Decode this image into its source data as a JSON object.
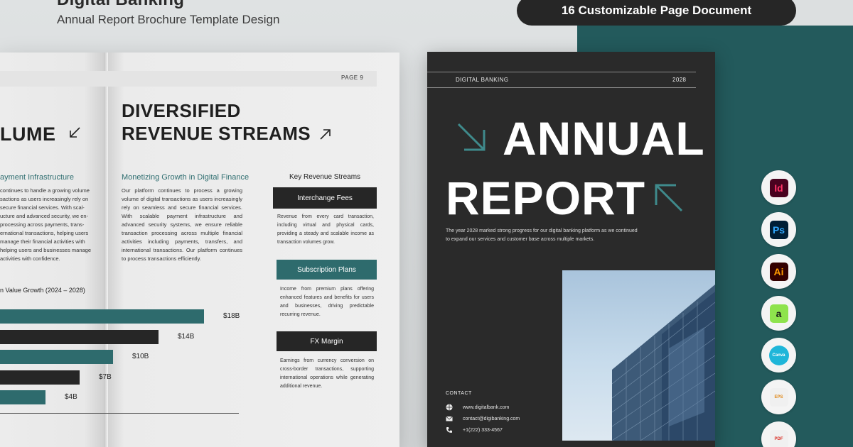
{
  "header": {
    "title": "Digital Banking",
    "subtitle": "Annual Report Brochure Template Design",
    "badge": "16 Customizable Page Document"
  },
  "spread": {
    "page_number": "PAGE 9",
    "left": {
      "title_fragment": "LUME",
      "heading": "ayment Infrastructure",
      "paragraph": "continues to handle a growing volume sactions as users increasingly rely on secure financial services. With scal-ucture and advanced security, we en-processing across payments, trans-ernational transactions, helping users manage their financial activities with helping users and businesses manage activities with confidence.",
      "chart_title": "n Value Growth (2024 – 2028)"
    },
    "middle": {
      "title": "DIVERSIFIED REVENUE STREAMS",
      "heading": "Monetizing Growth in Digital Finance",
      "paragraph": "Our platform continues to process a growing volume of digital transactions as users increasingly rely on seamless and secure financial services. With scalable payment infrastructure and advanced security systems, we ensure reliable transaction processing across multiple financial activities including payments, transfers, and international transactions. Our platform continues to process transactions efficiently."
    },
    "revenue": {
      "title": "Key Revenue Streams",
      "items": [
        {
          "label": "Interchange Fees",
          "text": "Revenue from every card transaction, including virtual and physical cards, providing a steady and scalable income as transaction volumes grow."
        },
        {
          "label": "Subscription Plans",
          "text": "Income from premium plans offering enhanced features and benefits for users and businesses, driving predictable recurring revenue."
        },
        {
          "label": "FX Margin",
          "text": "Earnings from currency conversion on cross-border transactions, supporting international operations while generating additional revenue."
        }
      ]
    }
  },
  "chart_data": {
    "type": "bar",
    "orientation": "horizontal",
    "title": "n Value Growth (2024 – 2028)",
    "values": [
      18,
      14,
      10,
      7,
      4
    ],
    "value_labels": [
      "$18B",
      "$14B",
      "$10B",
      "$7B",
      "$4B"
    ],
    "colors": [
      "#2e6b6d",
      "#262626",
      "#2e6b6d",
      "#262626",
      "#2e6b6d"
    ],
    "xlim": [
      0,
      21
    ]
  },
  "cover": {
    "brand": "DIGITAL BANKING",
    "year": "2028",
    "title_line1": "ANNUAL",
    "title_line2": "REPORT",
    "intro": "The year 2028 marked strong progress for our digital banking platform as we continued to expand our services and customer base across multiple markets.",
    "contact_heading": "CONTACT",
    "contacts": [
      {
        "icon": "globe-icon",
        "text": "www.digitalbank.com"
      },
      {
        "icon": "mail-icon",
        "text": "contact@digibanking.com"
      },
      {
        "icon": "phone-icon",
        "text": "+1(222) 333-4567"
      }
    ]
  },
  "apps": [
    {
      "name": "indesign-icon",
      "label": "Id",
      "bg": "#49021f",
      "fg": "#ff3366"
    },
    {
      "name": "photoshop-icon",
      "label": "Ps",
      "bg": "#001e36",
      "fg": "#31a8ff"
    },
    {
      "name": "illustrator-icon",
      "label": "Ai",
      "bg": "#330000",
      "fg": "#ff9a00"
    },
    {
      "name": "affinity-icon",
      "label": "a",
      "bg": "#8ee34d",
      "fg": "#1a1a1a"
    },
    {
      "name": "canva-icon",
      "label": "Canva",
      "bg": "#1fb6d9",
      "fg": "#ffffff"
    },
    {
      "name": "eps-file-icon",
      "label": "EPS",
      "bg": "#f0f0f0",
      "fg": "#e08a1c"
    },
    {
      "name": "pdf-file-icon",
      "label": "PDF",
      "bg": "#f0f0f0",
      "fg": "#d9342b"
    }
  ],
  "colors": {
    "teal": "#2e6b6d",
    "dark": "#262626",
    "bg_right": "#235a5c"
  }
}
